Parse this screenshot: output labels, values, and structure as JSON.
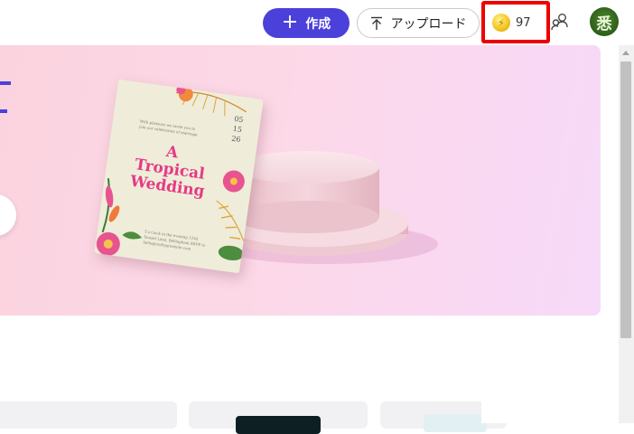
{
  "toolbar": {
    "create_label": "作成",
    "create_icon": "plus-icon",
    "upload_label": "アップロード",
    "upload_icon": "upload-arrow-icon",
    "credits_count": "97",
    "credits_icon": "coin-icon",
    "people_icon": "people-icon",
    "avatar_text": "悉"
  },
  "hero": {
    "card": {
      "title_line1": "A",
      "title_line2": "Tropical",
      "title_line3": "Wedding",
      "date_day": "05",
      "date_month": "15",
      "date_year": "26",
      "intro_text": "With pleasure we invite you to join our celebration of marriage",
      "footer_text": "5 o'clock in the evening 1234 Sunset Lane, Bellingham RSVP to hello@reallygreatsite.com"
    }
  },
  "colors": {
    "accent": "#4b40d9",
    "highlight": "#ee0000",
    "card_title": "#e53a86"
  }
}
